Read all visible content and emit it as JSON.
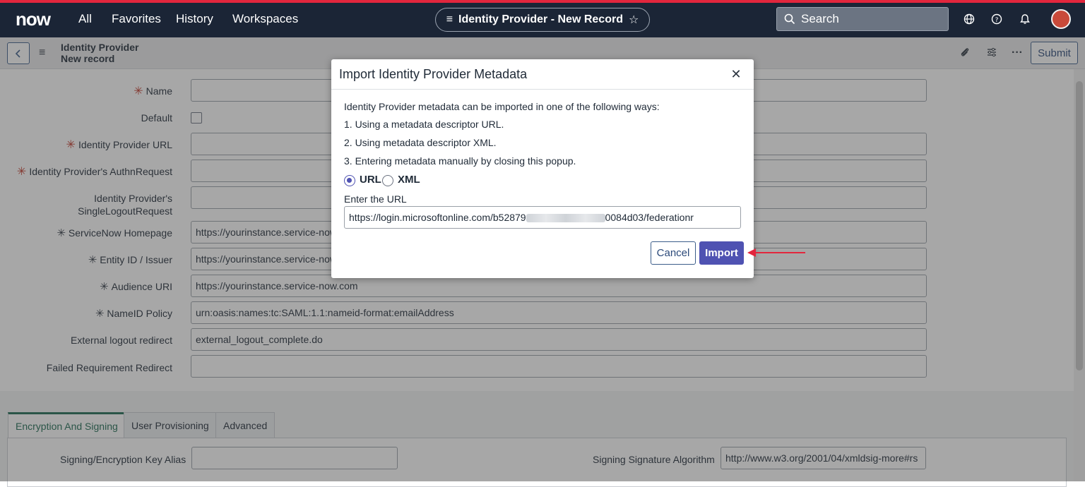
{
  "topbar": {
    "logo": "now",
    "nav": [
      "All",
      "Favorites",
      "History",
      "Workspaces"
    ],
    "record_title": "Identity Provider - New Record",
    "search_placeholder": "Search",
    "accent": "#e2263d",
    "bg": "#1b2536"
  },
  "header": {
    "title_line1": "Identity Provider",
    "title_line2": "New record",
    "submit_label": "Submit"
  },
  "form": {
    "fields": [
      {
        "label": "Name",
        "value": "",
        "required": "red"
      },
      {
        "label": "Default",
        "type": "checkbox"
      },
      {
        "label": "Identity Provider URL",
        "value": "",
        "required": "red"
      },
      {
        "label": "Identity Provider's AuthnRequest",
        "value": "",
        "required": "red"
      },
      {
        "label_line1": "Identity Provider's",
        "label_line2": "SingleLogoutRequest",
        "value": ""
      },
      {
        "label": "ServiceNow Homepage",
        "value": "https://yourinstance.service-now",
        "required": "grey"
      },
      {
        "label": "Entity ID / Issuer",
        "value": "https://yourinstance.service-now",
        "required": "grey"
      },
      {
        "label": "Audience URI",
        "value": "https://yourinstance.service-now.com",
        "required": "grey"
      },
      {
        "label": "NameID Policy",
        "value": "urn:oasis:names:tc:SAML:1.1:nameid-format:emailAddress",
        "required": "grey"
      },
      {
        "label": "External logout redirect",
        "value": "external_logout_complete.do"
      },
      {
        "label": "Failed Requirement Redirect",
        "value": ""
      }
    ]
  },
  "tabs": {
    "items": [
      "Encryption And Signing",
      "User Provisioning",
      "Advanced"
    ],
    "active": "Encryption And Signing",
    "signing_alias_label": "Signing/Encryption Key Alias",
    "signing_algorithm_label": "Signing Signature Algorithm",
    "signing_algorithm_value": "http://www.w3.org/2001/04/xmldsig-more#rs"
  },
  "modal": {
    "title": "Import Identity Provider Metadata",
    "intro": "Identity Provider metadata can be imported in one of the following ways:",
    "option1": "1. Using a metadata descriptor URL.",
    "option2": "2. Using metadata descriptor XML.",
    "option3": "3. Entering metadata manually by closing this popup.",
    "radio_url": "URL",
    "radio_xml": "XML",
    "selected": "URL",
    "url_label": "Enter the URL",
    "url_prefix": "https://login.microsoftonline.com/b52879",
    "url_suffix": "0084d03/federationr",
    "cancel_label": "Cancel",
    "import_label": "Import",
    "primary_color": "#4f52b2"
  }
}
